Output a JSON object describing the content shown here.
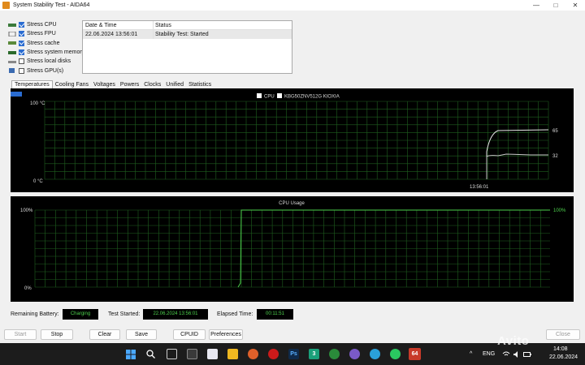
{
  "window": {
    "title": "System Stability Test - AIDA64",
    "controls": {
      "minimize": "—",
      "maximize": "□",
      "close": "✕"
    }
  },
  "stress": [
    {
      "label": "Stress CPU",
      "checked": true,
      "icon": "cpu-icon"
    },
    {
      "label": "Stress FPU",
      "checked": true,
      "icon": "fpu-icon"
    },
    {
      "label": "Stress cache",
      "checked": true,
      "icon": "cache-icon"
    },
    {
      "label": "Stress system memory",
      "checked": true,
      "icon": "memory-icon"
    },
    {
      "label": "Stress local disks",
      "checked": false,
      "icon": "disk-icon"
    },
    {
      "label": "Stress GPU(s)",
      "checked": false,
      "icon": "gpu-icon"
    }
  ],
  "status_table": {
    "headers": [
      "Date & Time",
      "Status"
    ],
    "rows": [
      [
        "22.06.2024 13:56:01",
        "Stability Test: Started"
      ]
    ]
  },
  "tabs": [
    "Temperatures",
    "Cooling Fans",
    "Voltages",
    "Powers",
    "Clocks",
    "Unified",
    "Statistics"
  ],
  "active_tab": "Temperatures",
  "temp_chart": {
    "legend": [
      "CPU",
      "KBG50ZNV512G KIOXIA"
    ],
    "y_top": "100 °C",
    "y_bottom": "0 °C",
    "time_label": "13:56:01",
    "value_1": "65",
    "value_2": "32",
    "line_color": "#ffffff",
    "grid_color": "#1f5f1f"
  },
  "cpu_chart": {
    "title": "CPU Usage",
    "y_top": "100%",
    "y_bottom": "0%",
    "value_right": "100%",
    "line_color": "#4dd14d"
  },
  "status_bar": {
    "battery_label": "Remaining Battery:",
    "battery_value": "Charging",
    "started_label": "Test Started:",
    "started_value": "22.06.2024 13:56:01",
    "elapsed_label": "Elapsed Time:",
    "elapsed_value": "00:11:51"
  },
  "buttons": {
    "start": "Start",
    "stop": "Stop",
    "clear": "Clear",
    "save": "Save",
    "cpuid": "CPUID",
    "preferences": "Preferences",
    "close": "Close"
  },
  "taskbar": {
    "lang": "ENG",
    "time": "14:08",
    "date": "22.06.2024",
    "aida_label": "64",
    "ps_label": "Ps",
    "three_label": "3",
    "overflow": "^"
  },
  "watermark": "Avito"
}
